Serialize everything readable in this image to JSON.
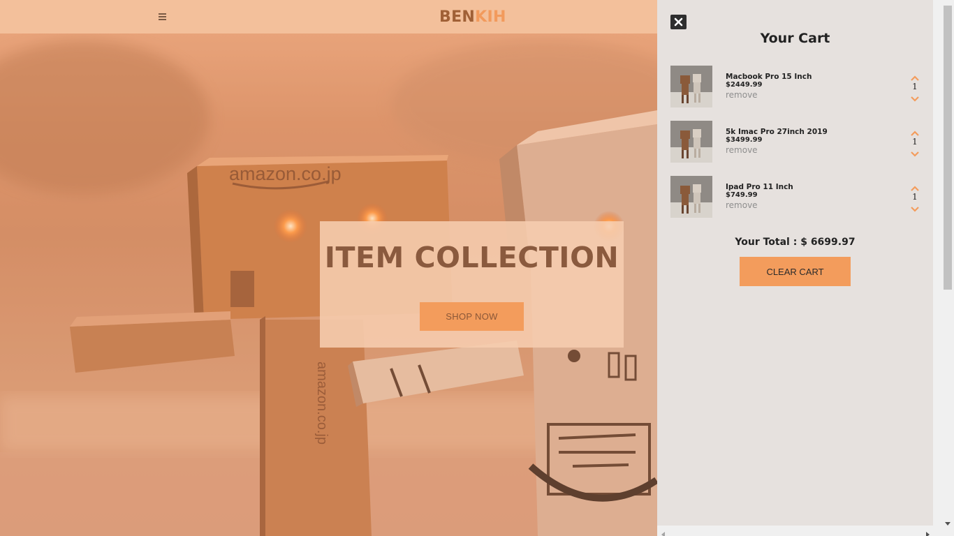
{
  "navbar": {
    "brand_part1": "BEN",
    "brand_part2": "KIH",
    "menu_icon": "hamburger-icon"
  },
  "hero": {
    "title": "ITEM COLLECTION",
    "button_label": "SHOP NOW"
  },
  "cart": {
    "title": "Your Cart",
    "close_icon": "close-icon",
    "items": [
      {
        "name": "Macbook Pro 15 Inch",
        "price": "$2449.99",
        "remove_label": "remove",
        "quantity": "1"
      },
      {
        "name": "5k Imac Pro 27inch 2019",
        "price": "$3499.99",
        "remove_label": "remove",
        "quantity": "1"
      },
      {
        "name": "Ipad Pro 11 Inch",
        "price": "$749.99",
        "remove_label": "remove",
        "quantity": "1"
      }
    ],
    "total_label": "Your Total : $ 6699.97",
    "clear_label": "CLEAR CART"
  },
  "colors": {
    "accent": "#f39c5c",
    "brand_dark": "#a06036",
    "cart_bg": "#e6e1de",
    "navbar_bg": "#f3c09b"
  }
}
